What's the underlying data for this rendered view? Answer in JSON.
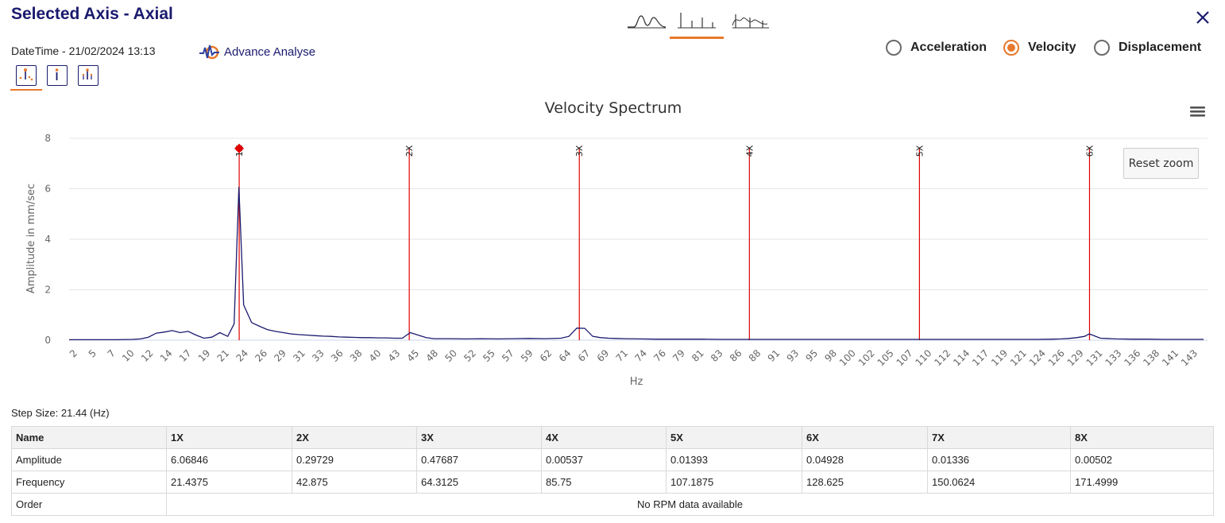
{
  "header": {
    "title": "Selected Axis - Axial",
    "datetime": "DateTime - 21/02/2024 13:13",
    "advance_label": "Advance Analyse"
  },
  "chart_types": [
    {
      "name": "waveform",
      "icon": "waveform-chart-icon",
      "active": false
    },
    {
      "name": "spectrum",
      "icon": "spectrum-chart-icon",
      "active": true
    },
    {
      "name": "combined",
      "icon": "combined-chart-icon",
      "active": false
    }
  ],
  "measure_options": [
    {
      "label": "Acceleration",
      "selected": false
    },
    {
      "label": "Velocity",
      "selected": true
    },
    {
      "label": "Displacement",
      "selected": false
    }
  ],
  "colors": {
    "accent": "#e8792d",
    "navy": "#1a1a6e",
    "line": "#1a1a6e",
    "marker": "#e00000"
  },
  "reset_zoom_label": "Reset zoom",
  "chart_data": {
    "type": "line",
    "title": "Velocity Spectrum",
    "xlabel": "Hz",
    "ylabel": "Amplitude in mm/sec",
    "ylim": [
      0,
      8
    ],
    "yticks": [
      0,
      2,
      4,
      6,
      8
    ],
    "xlim": [
      0,
      143.5
    ],
    "grid": true,
    "x_tick_labels": [
      "2",
      "5",
      "7",
      "10",
      "12",
      "14",
      "17",
      "19",
      "21",
      "24",
      "26",
      "29",
      "31",
      "33",
      "36",
      "38",
      "40",
      "43",
      "45",
      "48",
      "50",
      "52",
      "55",
      "57",
      "59",
      "62",
      "64",
      "67",
      "69",
      "71",
      "74",
      "76",
      "79",
      "81",
      "83",
      "86",
      "88",
      "91",
      "93",
      "95",
      "98",
      "100",
      "102",
      "105",
      "107",
      "110",
      "112",
      "114",
      "117",
      "119",
      "121",
      "124",
      "126",
      "129",
      "131",
      "133",
      "136",
      "138",
      "141",
      "143"
    ],
    "series": [
      {
        "x": [
          0,
          2,
          4,
          6,
          8,
          9,
          10,
          11,
          12,
          13,
          14,
          15,
          16,
          17,
          18,
          19,
          20,
          20.8,
          21.4,
          22,
          23,
          24,
          25,
          26,
          27,
          28,
          29,
          30,
          31,
          32,
          33,
          34,
          35,
          36,
          37,
          38,
          39,
          40,
          41,
          42,
          43,
          44,
          45,
          46,
          48,
          50,
          52,
          54,
          56,
          58,
          60,
          62,
          63,
          64,
          65,
          66,
          67,
          68,
          69,
          70,
          72,
          74,
          76,
          78,
          80,
          82,
          84,
          86,
          88,
          90,
          92,
          94,
          96,
          98,
          100,
          102,
          104,
          106,
          108,
          110,
          112,
          114,
          116,
          118,
          120,
          122,
          124,
          125,
          126,
          127,
          128,
          128.6,
          129,
          130,
          132,
          134,
          136,
          138,
          140,
          143
        ],
        "y": [
          0.02,
          0.02,
          0.02,
          0.02,
          0.03,
          0.05,
          0.12,
          0.28,
          0.32,
          0.38,
          0.3,
          0.35,
          0.2,
          0.08,
          0.12,
          0.3,
          0.15,
          0.65,
          6.07,
          1.4,
          0.7,
          0.55,
          0.42,
          0.35,
          0.3,
          0.25,
          0.22,
          0.2,
          0.18,
          0.16,
          0.15,
          0.13,
          0.12,
          0.11,
          0.1,
          0.1,
          0.09,
          0.09,
          0.08,
          0.08,
          0.3,
          0.2,
          0.1,
          0.06,
          0.06,
          0.05,
          0.06,
          0.05,
          0.06,
          0.07,
          0.06,
          0.08,
          0.15,
          0.48,
          0.47,
          0.15,
          0.1,
          0.08,
          0.07,
          0.06,
          0.05,
          0.04,
          0.04,
          0.04,
          0.04,
          0.03,
          0.03,
          0.03,
          0.03,
          0.03,
          0.03,
          0.03,
          0.03,
          0.03,
          0.03,
          0.03,
          0.03,
          0.03,
          0.03,
          0.03,
          0.03,
          0.03,
          0.03,
          0.03,
          0.03,
          0.03,
          0.04,
          0.05,
          0.07,
          0.1,
          0.15,
          0.25,
          0.2,
          0.08,
          0.05,
          0.04,
          0.04,
          0.03,
          0.03,
          0.03
        ]
      }
    ],
    "harmonic_markers": [
      {
        "label": "1X",
        "x": 21.4375
      },
      {
        "label": "2X",
        "x": 42.875
      },
      {
        "label": "3X",
        "x": 64.3125
      },
      {
        "label": "4X",
        "x": 85.75
      },
      {
        "label": "5X",
        "x": 107.1875
      },
      {
        "label": "6X",
        "x": 128.625
      }
    ]
  },
  "step_size": "Step Size: 21.44 (Hz)",
  "table": {
    "headers": [
      "Name",
      "1X",
      "2X",
      "3X",
      "4X",
      "5X",
      "6X",
      "7X",
      "8X"
    ],
    "rows": [
      [
        "Amplitude",
        "6.06846",
        "0.29729",
        "0.47687",
        "0.00537",
        "0.01393",
        "0.04928",
        "0.01336",
        "0.00502"
      ],
      [
        "Frequency",
        "21.4375",
        "42.875",
        "64.3125",
        "85.75",
        "107.1875",
        "128.625",
        "150.0624",
        "171.4999"
      ]
    ],
    "order_label": "Order",
    "order_value": "No RPM data available"
  }
}
